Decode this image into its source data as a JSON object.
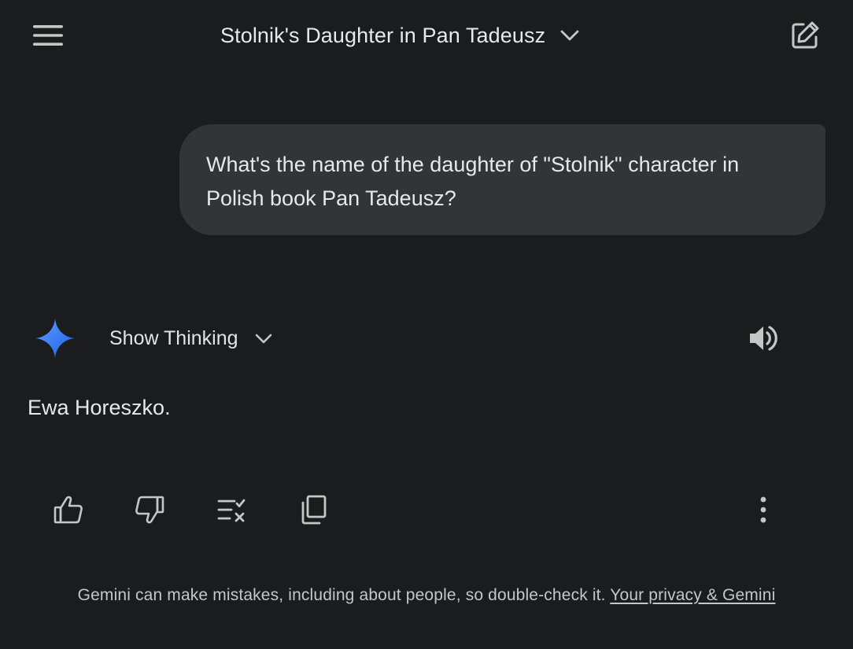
{
  "header": {
    "title": "Stolnik's Daughter in Pan Tadeusz",
    "menu_icon": "hamburger-menu-icon",
    "title_dropdown_icon": "chevron-down-icon",
    "new_chat_icon": "edit-square-icon"
  },
  "conversation": {
    "user_message": "What's the name of the daughter of \"Stolnik\" character in Polish book Pan Tadeusz?",
    "response": {
      "show_thinking_label": "Show Thinking",
      "text": "Ewa Horeszko.",
      "avatar_icon": "gemini-spark-icon",
      "speaker_icon": "volume-up-icon"
    },
    "actions": [
      {
        "name": "good-response",
        "icon": "thumb-up-icon"
      },
      {
        "name": "bad-response",
        "icon": "thumb-down-icon"
      },
      {
        "name": "double-check",
        "icon": "double-check-icon"
      },
      {
        "name": "copy",
        "icon": "copy-icon"
      },
      {
        "name": "more",
        "icon": "more-vert-icon"
      }
    ]
  },
  "footer": {
    "disclaimer": "Gemini can make mistakes, including about people, so double-check it.",
    "privacy_link": "Your privacy & Gemini"
  },
  "colors": {
    "background": "#1b1c1e",
    "user_bubble": "#333437",
    "text": "#e8e8e8",
    "secondary_text": "#c4c7c5",
    "spark_gradient_start": "#4f8df7",
    "spark_gradient_end": "#1a5fe0"
  }
}
